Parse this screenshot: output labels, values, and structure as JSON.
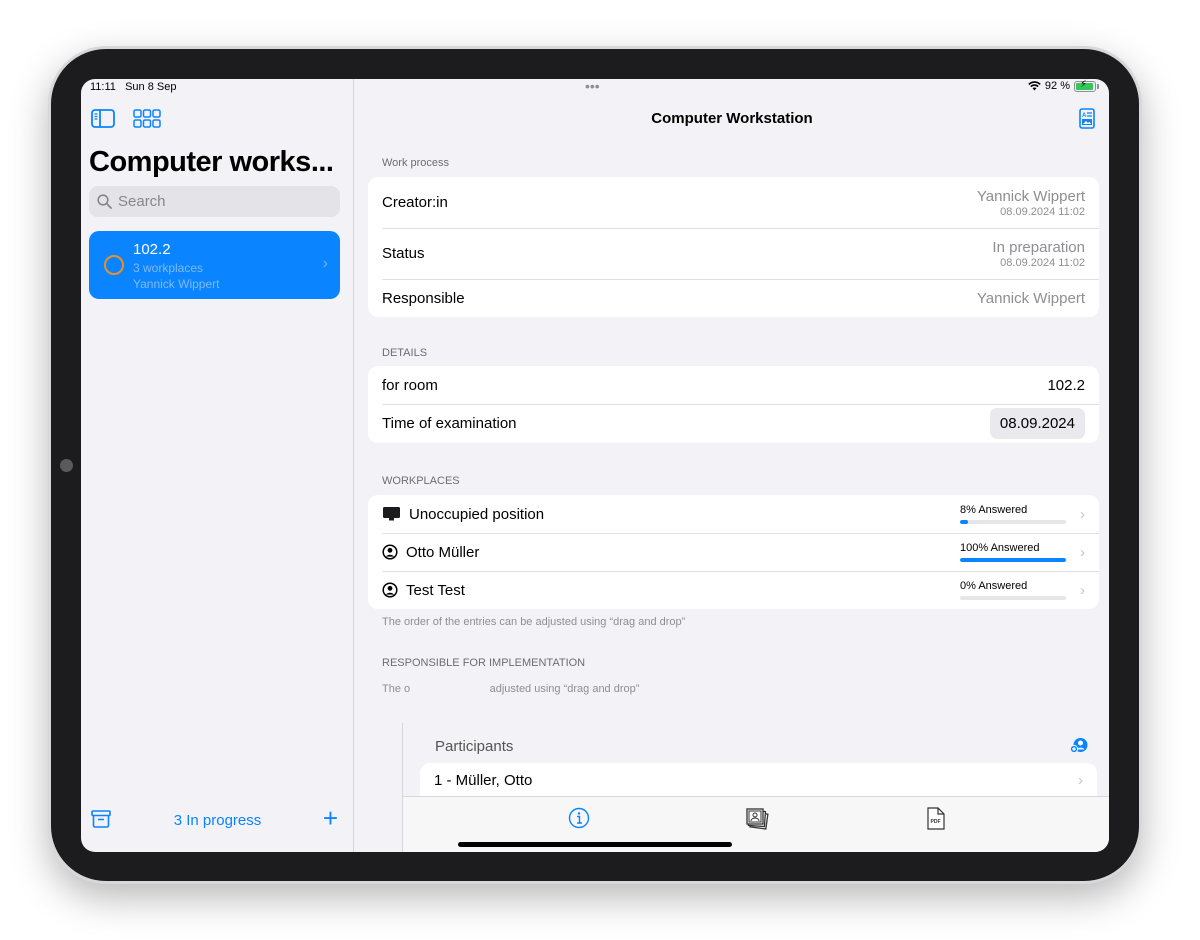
{
  "status_bar": {
    "time": "11:11",
    "date": "Sun 8 Sep",
    "battery": "92 %",
    "battery_level": 0.92,
    "multitask_dots": "•••"
  },
  "sidebar": {
    "title": "Computer works...",
    "search_placeholder": "Search",
    "items": [
      {
        "title": "102.2",
        "subtitle": "3 workplaces",
        "owner": "Yannick Wippert",
        "status_color": "#e8902a",
        "selected": true
      }
    ],
    "footer": {
      "label": "3 In progress"
    }
  },
  "main": {
    "title": "Computer Workstation",
    "work_process": {
      "header": "Work process",
      "rows": [
        {
          "label": "Creator:in",
          "value": "Yannick Wippert",
          "sub": "08.09.2024 11:02"
        },
        {
          "label": "Status",
          "value": "In preparation",
          "sub": "08.09.2024 11:02"
        },
        {
          "label": "Responsible",
          "value": "Yannick Wippert"
        }
      ]
    },
    "details": {
      "header": "DETAILS",
      "rows": [
        {
          "label": "for room",
          "value": "102.2"
        },
        {
          "label": "Time of examination",
          "value": "08.09.2024"
        }
      ]
    },
    "workplaces": {
      "header": "WORKPLACES",
      "rows": [
        {
          "label": "Unoccupied position",
          "icon": "desktop-icon",
          "progress_label": "8% Answered",
          "progress": 0.08
        },
        {
          "label": "Otto Müller",
          "icon": "person-circle-icon",
          "progress_label": "100% Answered",
          "progress": 1.0
        },
        {
          "label": "Test Test",
          "icon": "person-circle-icon",
          "progress_label": "0% Answered",
          "progress": 0.0
        }
      ],
      "footnote": "The order of the entries can be adjusted using “drag and drop”"
    },
    "responsible": {
      "header": "RESPONSIBLE FOR IMPLEMENTATION",
      "footnote_partial": "The o                          adjusted using “drag and drop”"
    }
  },
  "sheet": {
    "title": "Participants",
    "rows": [
      {
        "label": "1 - Müller, Otto"
      }
    ]
  },
  "tabbar": {
    "tabs": [
      "info-icon",
      "photos-icon",
      "pdf-icon"
    ],
    "selected": 0
  },
  "colors": {
    "accent": "#0a84ff",
    "status_orange": "#e8902a",
    "background": "#f2f2f7"
  }
}
